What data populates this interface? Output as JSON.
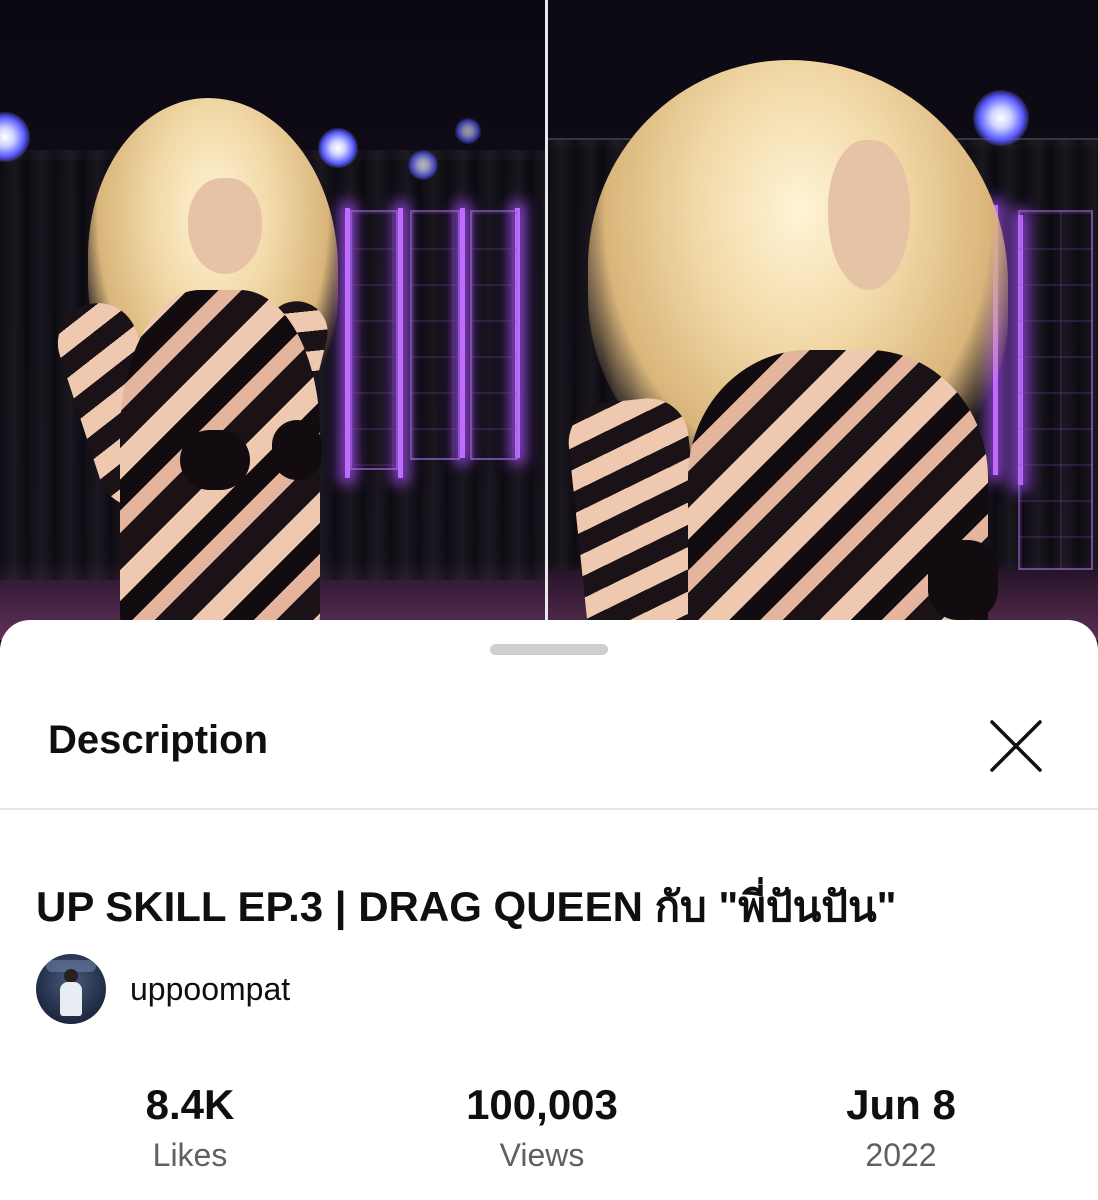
{
  "sheet": {
    "title": "Description",
    "close_icon": "close-icon"
  },
  "video": {
    "title": "UP SKILL EP.3 | DRAG QUEEN กับ \"พี่ปันปัน\"",
    "channel": "uppoompat",
    "stats": {
      "likes_value": "8.4K",
      "likes_label": "Likes",
      "views_value": "100,003",
      "views_label": "Views",
      "date_value": "Jun 8",
      "date_year": "2022"
    }
  }
}
